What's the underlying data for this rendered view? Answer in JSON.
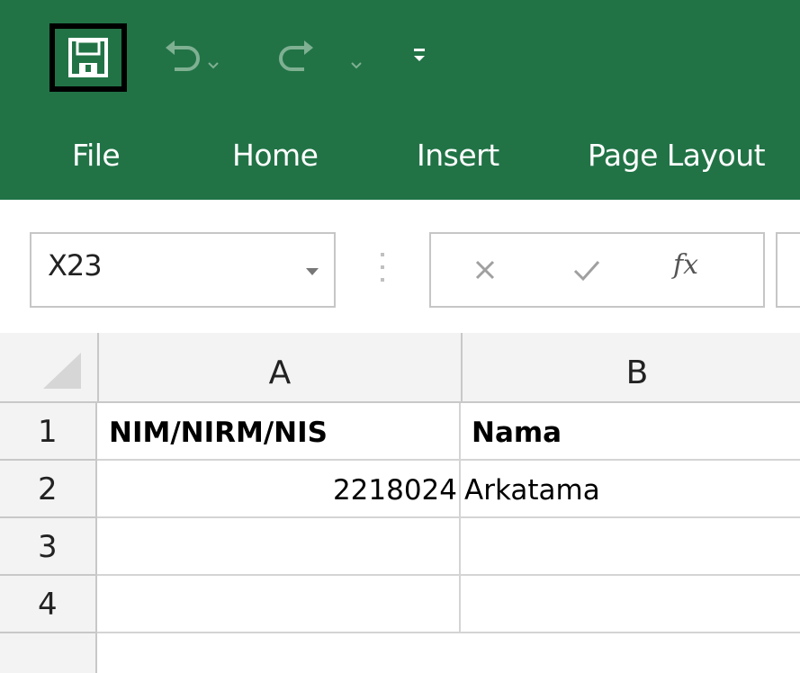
{
  "ribbon": {
    "color": "#217346",
    "quick_access": {
      "save": "save-icon",
      "undo": "undo-icon",
      "redo": "redo-icon",
      "customize": "customize-qat-icon"
    },
    "tabs": [
      {
        "label": "File"
      },
      {
        "label": "Home"
      },
      {
        "label": "Insert"
      },
      {
        "label": "Page Layout"
      }
    ]
  },
  "formula_bar": {
    "name_box": "X23",
    "fx_label": "fx",
    "formula_value": ""
  },
  "sheet": {
    "columns": [
      "A",
      "B"
    ],
    "rows": [
      {
        "num": "1",
        "cells": [
          "NIM/NIRM/NIS",
          "Nama"
        ]
      },
      {
        "num": "2",
        "cells": [
          "2218024",
          "Arkatama"
        ]
      },
      {
        "num": "3",
        "cells": [
          "",
          ""
        ]
      },
      {
        "num": "4",
        "cells": [
          "",
          ""
        ]
      }
    ]
  }
}
